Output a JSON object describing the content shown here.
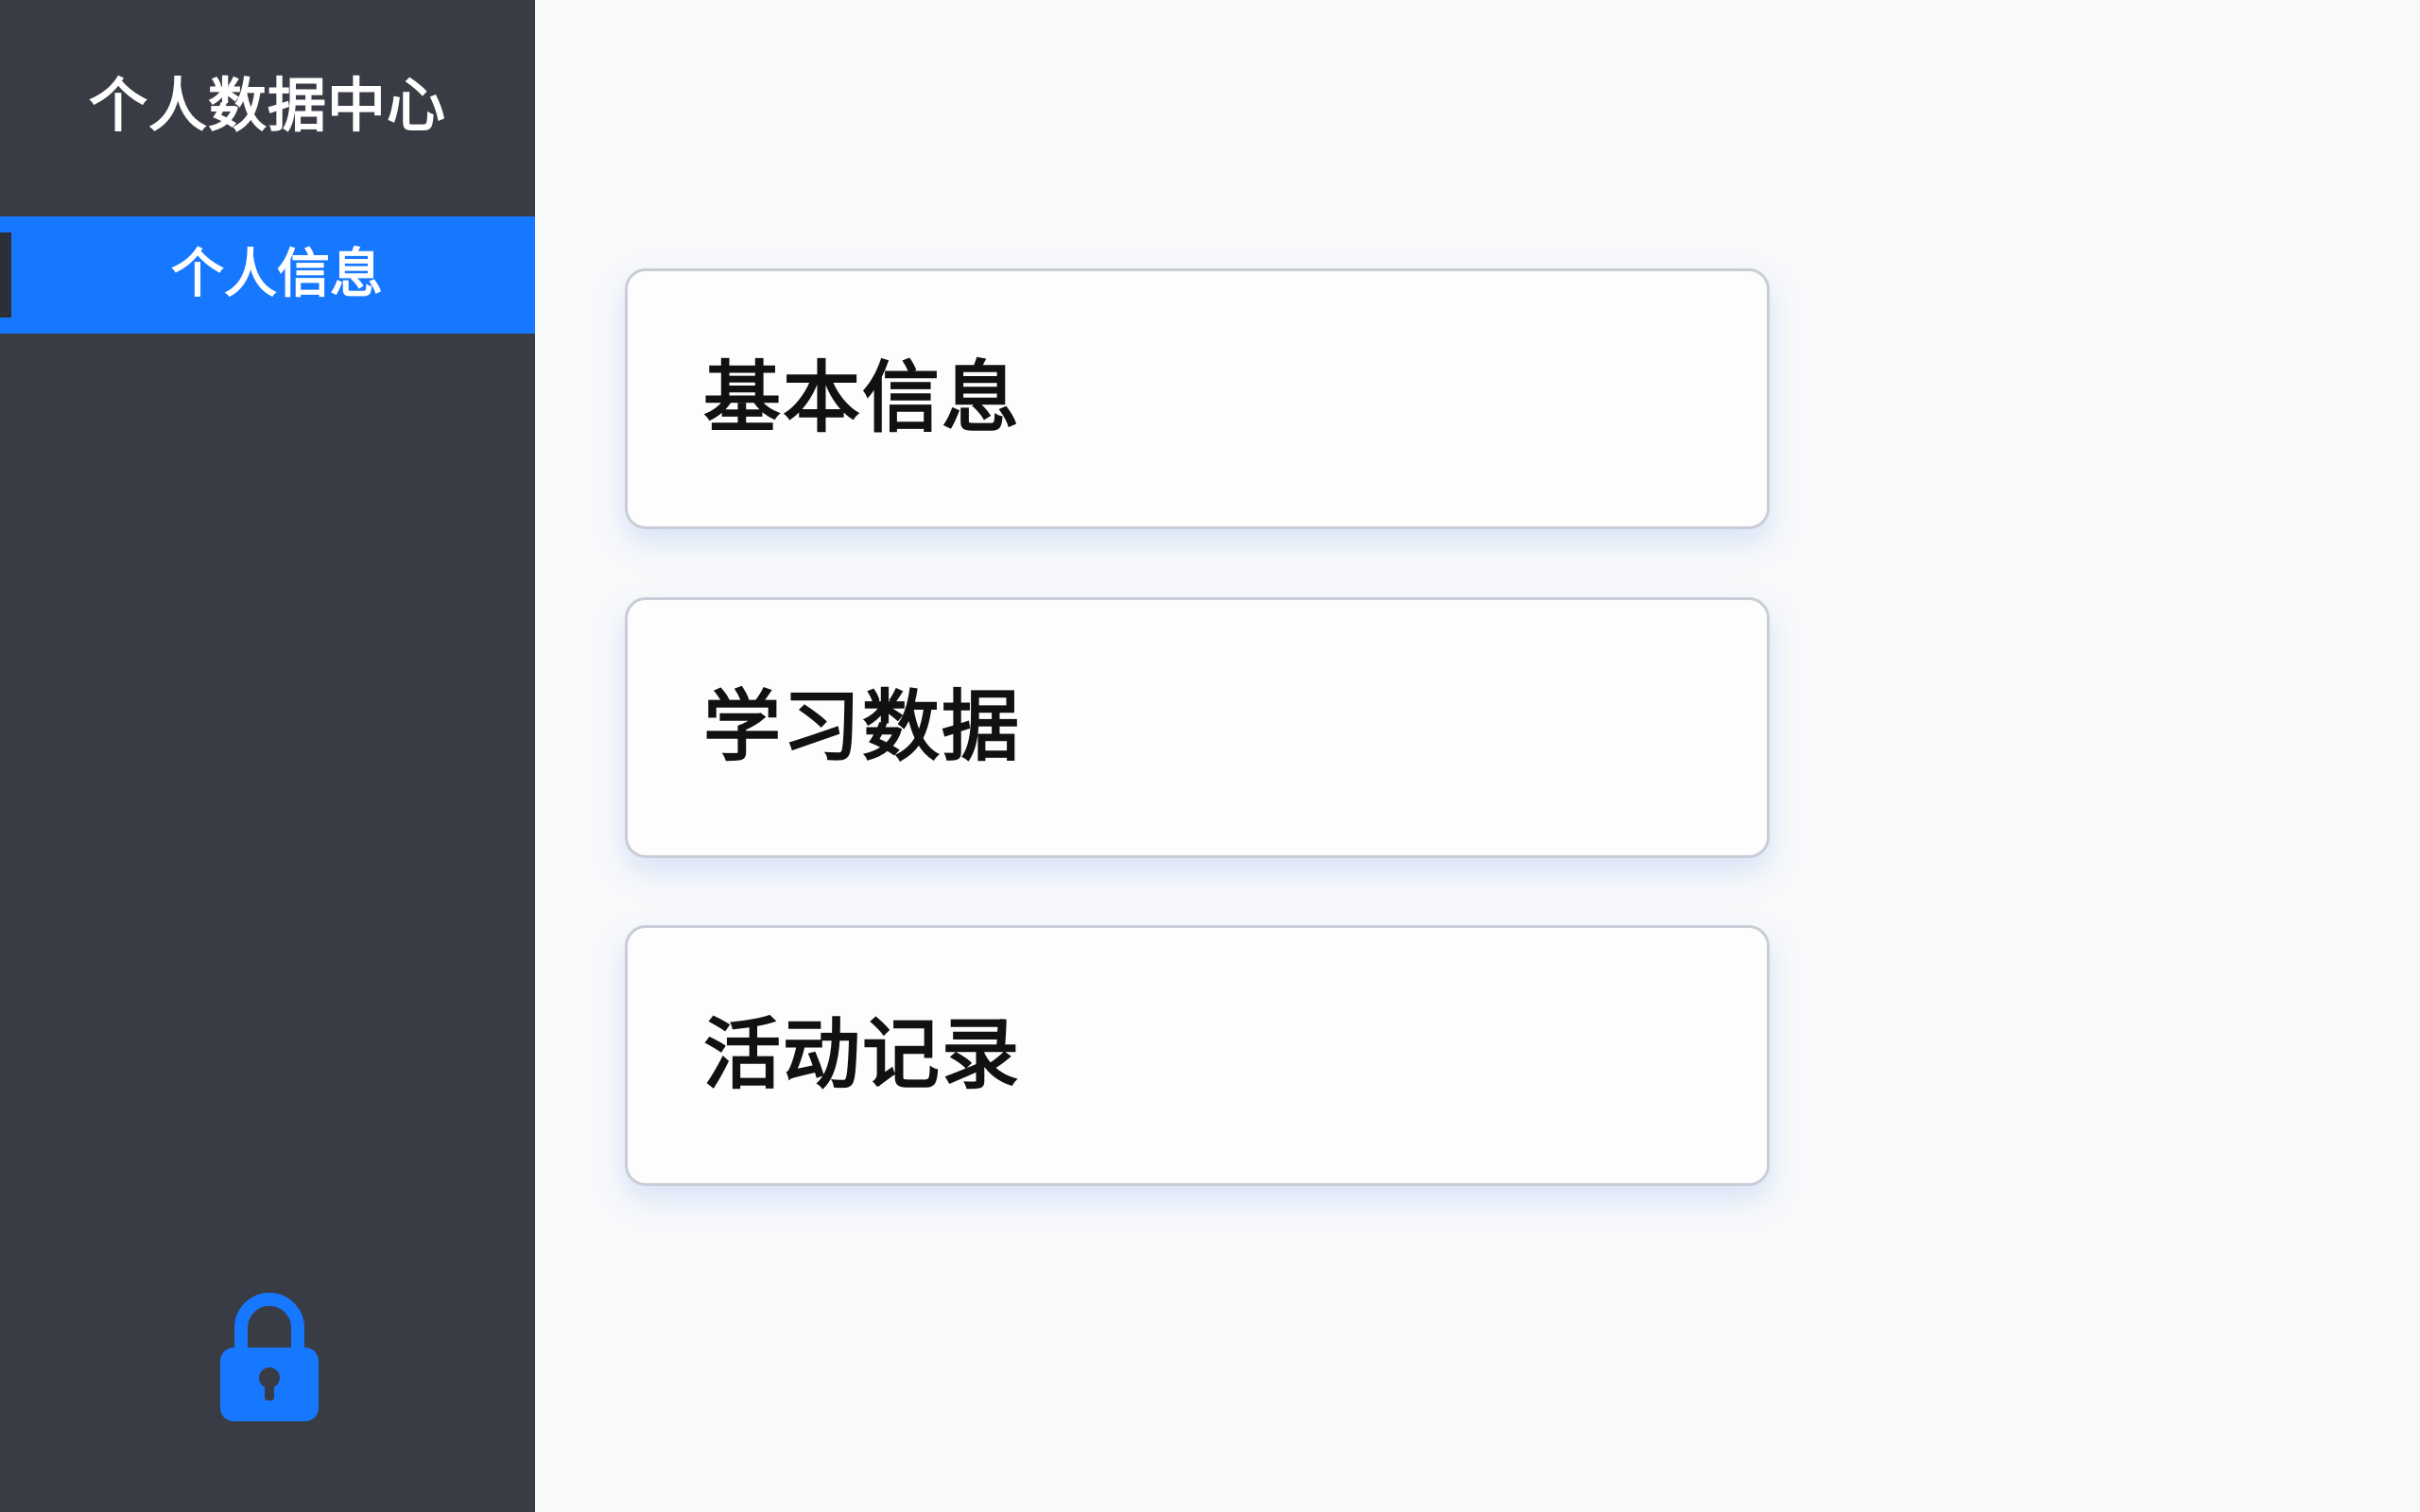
{
  "sidebar": {
    "title": "个人数据中心",
    "items": [
      {
        "label": "个人信息",
        "active": true
      }
    ],
    "lock_icon": "lock-icon",
    "accent_color": "#1677ff",
    "background_color": "#393c45"
  },
  "main": {
    "cards": [
      {
        "label": "基本信息"
      },
      {
        "label": "学习数据"
      },
      {
        "label": "活动记录"
      }
    ]
  }
}
